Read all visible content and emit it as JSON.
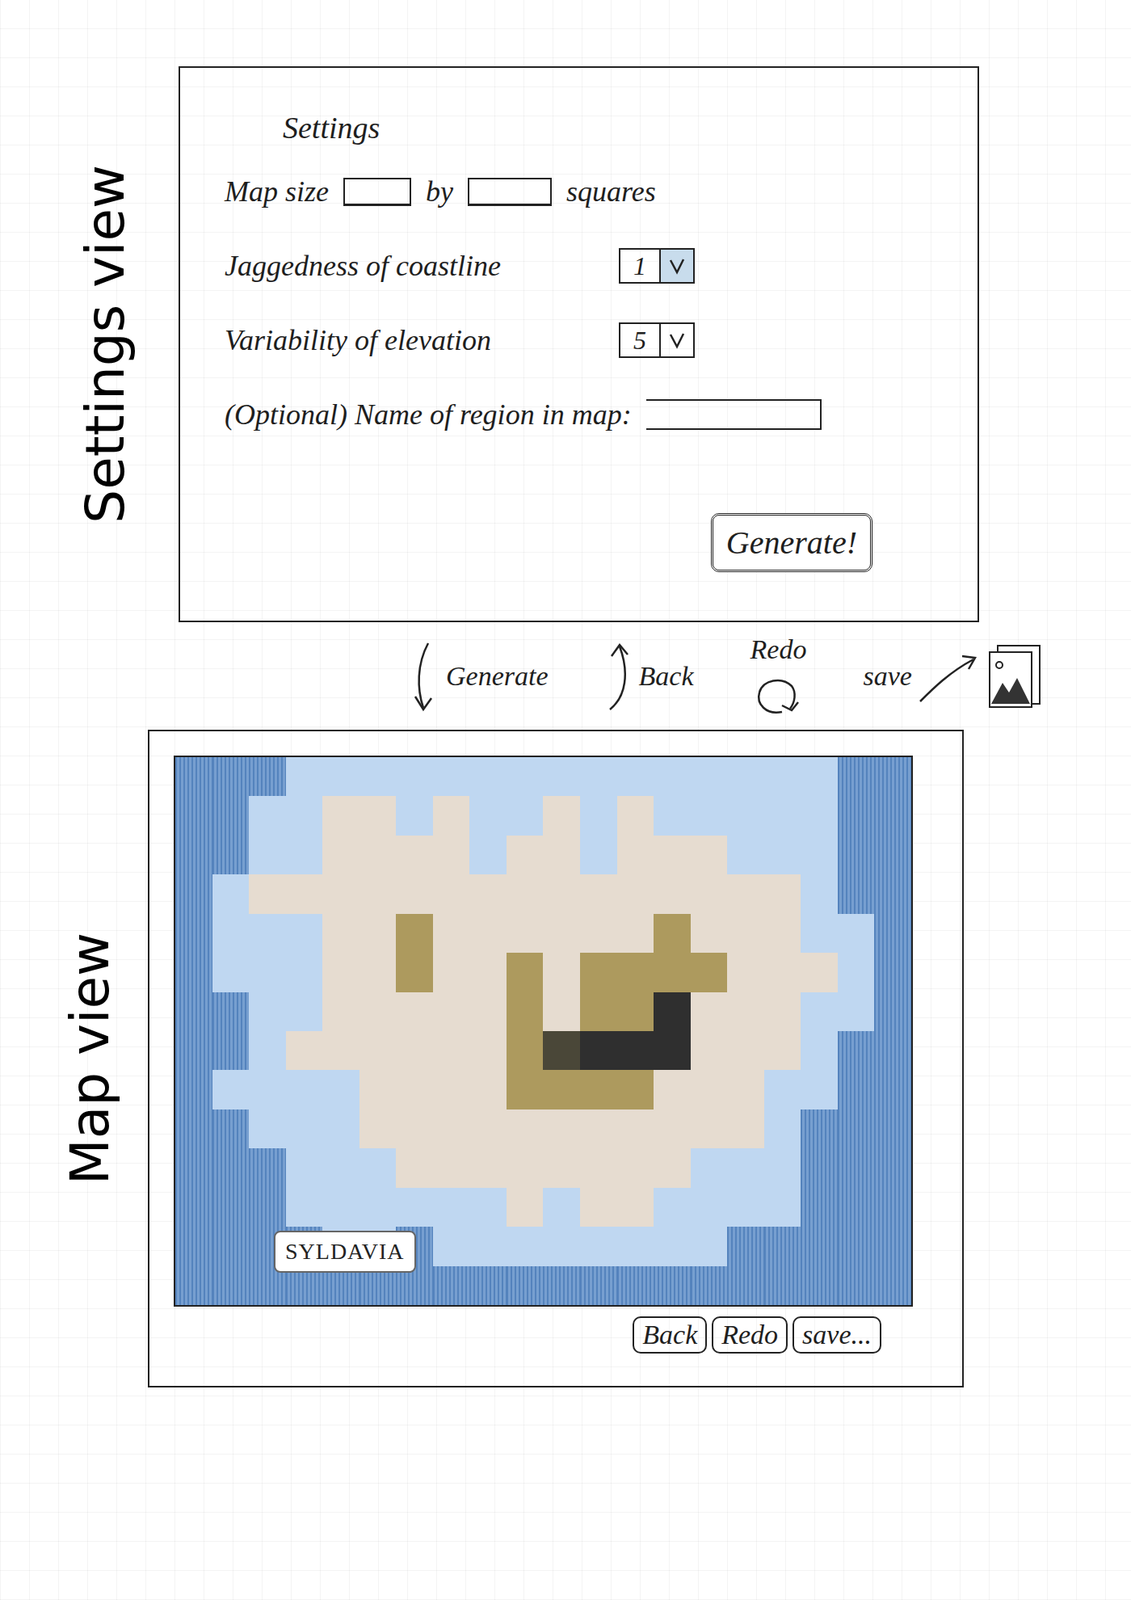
{
  "labels": {
    "settings_view": "Settings view",
    "map_view": "Map view"
  },
  "settings": {
    "title": "Settings",
    "map_size": {
      "label": "Map size",
      "between": "by",
      "unit": "squares"
    },
    "fields": [
      {
        "label": "Jaggedness of coastline",
        "value": "1"
      },
      {
        "label": "Variability of elevation",
        "value": "5"
      }
    ],
    "region": {
      "label": "(Optional) Name of region in map:"
    },
    "button": "Generate!"
  },
  "transitions": [
    {
      "label": "Generate",
      "kind": "down"
    },
    {
      "label": "Back",
      "kind": "up"
    },
    {
      "label": "Redo",
      "kind": "redo"
    },
    {
      "label": "save",
      "kind": "save"
    }
  ],
  "map": {
    "region_name": "SYLDAVIA",
    "elevation": [
      [
        0,
        0,
        0,
        1,
        1,
        1,
        1,
        1,
        1,
        1,
        1,
        1,
        1,
        1,
        1,
        1,
        1,
        1,
        0,
        0
      ],
      [
        0,
        0,
        1,
        1,
        2,
        2,
        1,
        2,
        1,
        1,
        2,
        1,
        2,
        1,
        1,
        1,
        1,
        1,
        0,
        0
      ],
      [
        0,
        0,
        1,
        1,
        2,
        2,
        2,
        2,
        1,
        2,
        2,
        1,
        2,
        2,
        2,
        1,
        1,
        1,
        0,
        0
      ],
      [
        0,
        1,
        2,
        2,
        2,
        2,
        2,
        2,
        2,
        2,
        2,
        2,
        2,
        2,
        2,
        2,
        2,
        1,
        0,
        0
      ],
      [
        0,
        1,
        1,
        1,
        2,
        2,
        3,
        2,
        2,
        2,
        2,
        2,
        2,
        3,
        2,
        2,
        2,
        1,
        1,
        0
      ],
      [
        0,
        1,
        1,
        1,
        2,
        2,
        3,
        2,
        2,
        3,
        2,
        3,
        3,
        3,
        3,
        2,
        2,
        2,
        1,
        0
      ],
      [
        0,
        0,
        1,
        1,
        2,
        2,
        2,
        2,
        2,
        3,
        2,
        3,
        3,
        5,
        2,
        2,
        2,
        1,
        1,
        0
      ],
      [
        0,
        0,
        1,
        2,
        2,
        2,
        2,
        2,
        2,
        3,
        4,
        5,
        5,
        5,
        2,
        2,
        2,
        1,
        0,
        0
      ],
      [
        0,
        1,
        1,
        1,
        1,
        2,
        2,
        2,
        2,
        3,
        3,
        3,
        3,
        2,
        2,
        2,
        1,
        1,
        0,
        0
      ],
      [
        0,
        0,
        1,
        1,
        1,
        2,
        2,
        2,
        2,
        2,
        2,
        2,
        2,
        2,
        2,
        2,
        1,
        0,
        0,
        0
      ],
      [
        0,
        0,
        0,
        1,
        1,
        1,
        2,
        2,
        2,
        2,
        2,
        2,
        2,
        2,
        1,
        1,
        1,
        0,
        0,
        0
      ],
      [
        0,
        0,
        0,
        1,
        1,
        1,
        1,
        1,
        1,
        2,
        1,
        2,
        2,
        1,
        1,
        1,
        1,
        0,
        0,
        0
      ],
      [
        0,
        0,
        0,
        0,
        1,
        1,
        0,
        1,
        1,
        1,
        1,
        1,
        1,
        1,
        1,
        0,
        0,
        0,
        0,
        0
      ],
      [
        0,
        0,
        0,
        0,
        0,
        0,
        0,
        0,
        0,
        0,
        0,
        0,
        0,
        0,
        0,
        0,
        0,
        0,
        0,
        0
      ]
    ]
  },
  "buttons": [
    "Back",
    "Redo",
    "save..."
  ]
}
